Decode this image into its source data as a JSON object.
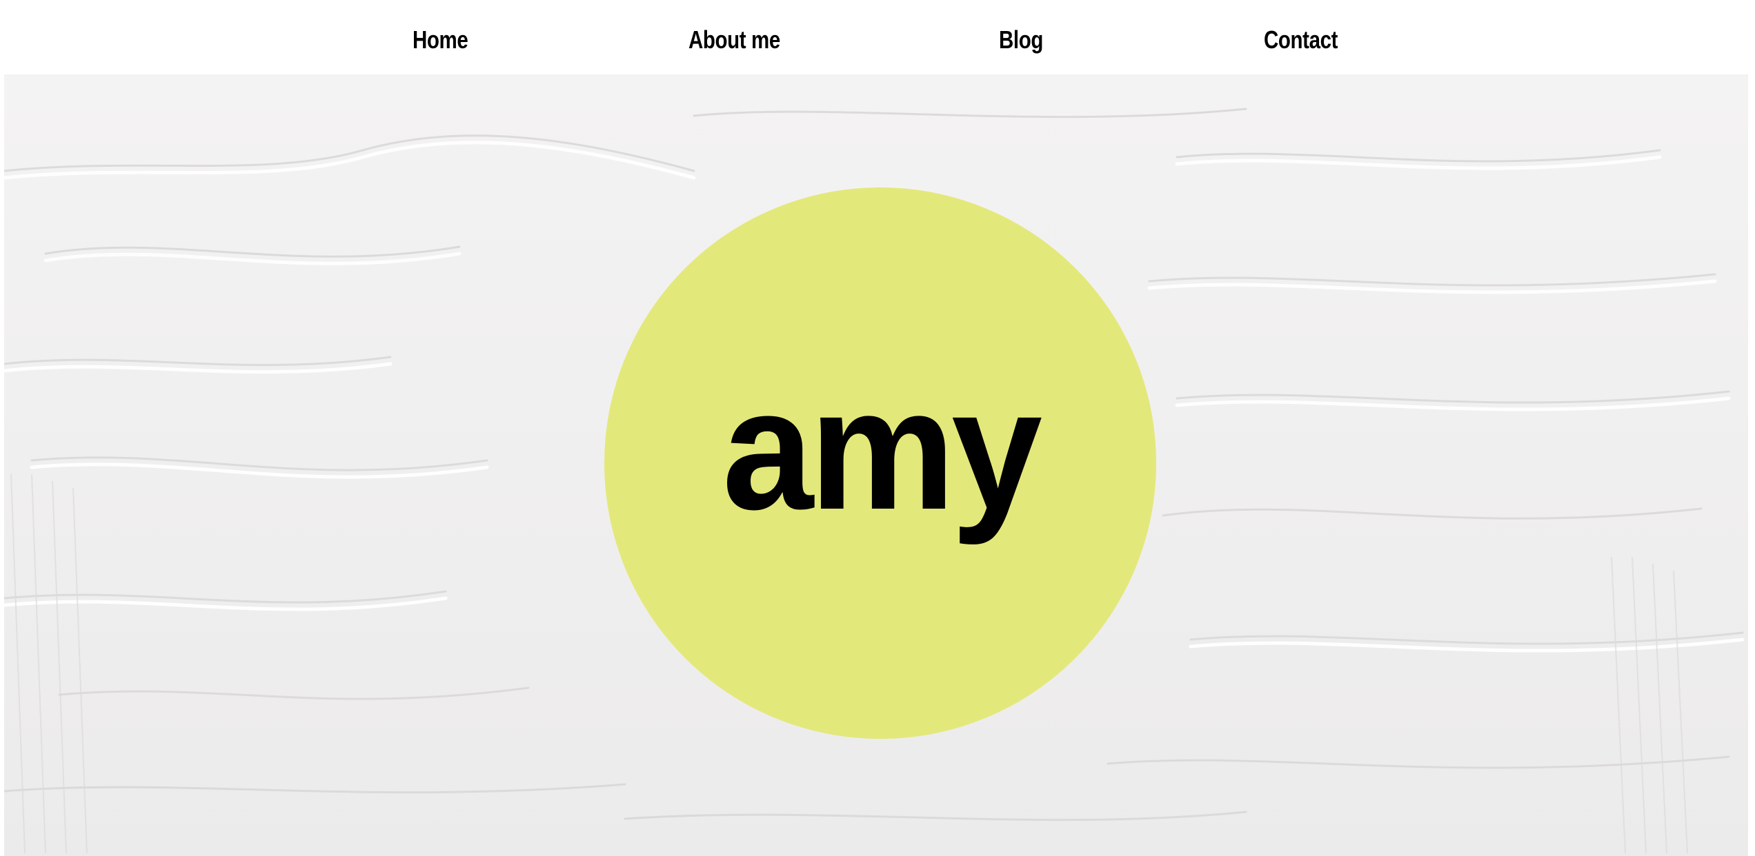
{
  "nav": {
    "items": [
      {
        "label": "Home"
      },
      {
        "label": "About me"
      },
      {
        "label": "Blog"
      },
      {
        "label": "Contact"
      }
    ]
  },
  "hero": {
    "logo_text": "amy",
    "circle_color": "#e3e87a",
    "background_color": "#f1f0f0"
  }
}
